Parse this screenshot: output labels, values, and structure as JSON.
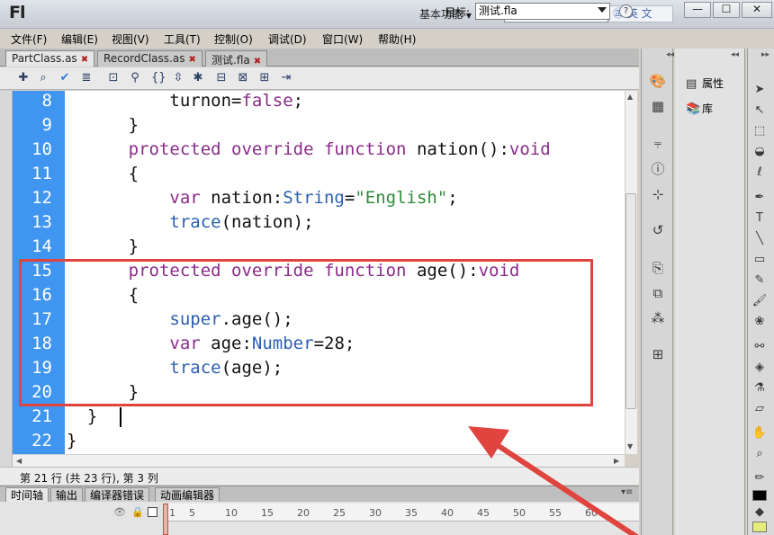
{
  "app": {
    "logo": "Fl",
    "workspace": "基本功能",
    "ime_text": "英 文",
    "window_buttons": [
      "—",
      "☐",
      "✕"
    ]
  },
  "menu": [
    "文件(F)",
    "编辑(E)",
    "视图(V)",
    "工具(T)",
    "控制(O)",
    "调试(D)",
    "窗口(W)",
    "帮助(H)"
  ],
  "tabs": [
    {
      "label": "PartClass.as",
      "active": true
    },
    {
      "label": "RecordClass.as",
      "active": false
    },
    {
      "label": "测试.fla",
      "active": false
    }
  ],
  "toolbar": {
    "target_label": "目标:",
    "target_value": "测试.fla",
    "help": "?"
  },
  "code": {
    "line_numbers": [
      "8",
      "9",
      "10",
      "11",
      "12",
      "13",
      "14",
      "15",
      "16",
      "17",
      "18",
      "19",
      "20",
      "21",
      "22"
    ]
  },
  "status": "第 21 行 (共 23 行), 第 3 列",
  "panel_tabs": [
    "时间轴",
    "输出",
    "编译器错误",
    "动画编辑器"
  ],
  "timeline_ticks": [
    "1",
    "5",
    "10",
    "15",
    "20",
    "25",
    "30",
    "35",
    "40",
    "45",
    "50",
    "55",
    "60"
  ],
  "right_panel": {
    "properties": "属性",
    "library": "库"
  },
  "colors": {
    "gutter": "#3f95ef",
    "keyword": "#8a2b8a",
    "type": "#2b5fb0",
    "string": "#2f8a3a",
    "highlight_box": "#e0443f",
    "annotation_arrow": "#e0443f"
  }
}
